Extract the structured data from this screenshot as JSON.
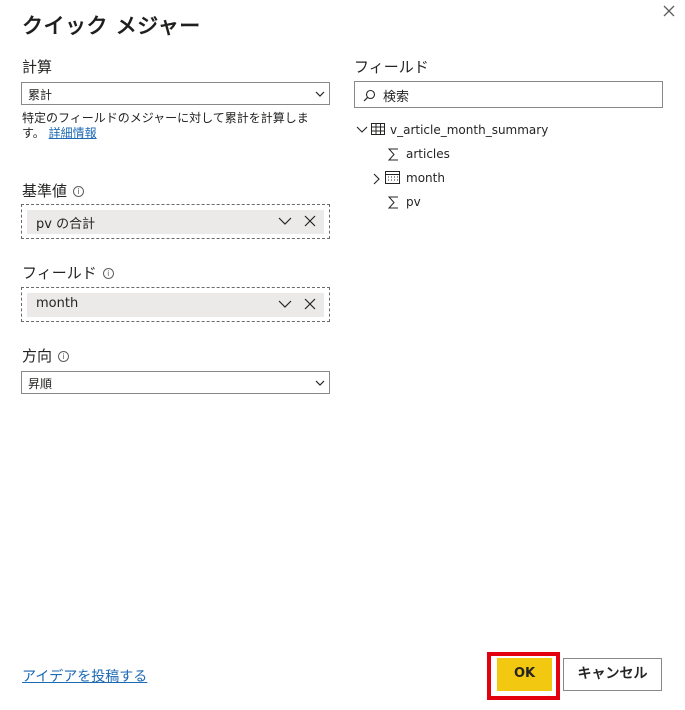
{
  "dialog": {
    "title": "クイック メジャー",
    "close_icon": "close-icon"
  },
  "calculation": {
    "label": "計算",
    "selected": "累計",
    "description": "特定のフィールドのメジャーに対して累計を計算します。",
    "learn_more": "詳細情報"
  },
  "base_value": {
    "label": "基準値",
    "value": "pv の合計"
  },
  "field": {
    "label": "フィールド",
    "value": "month"
  },
  "direction": {
    "label": "方向",
    "selected": "昇順"
  },
  "fields_pane": {
    "label": "フィールド",
    "search_placeholder": "検索",
    "table_name": "v_article_month_summary",
    "items": [
      {
        "label": "articles",
        "icon": "sigma-icon"
      },
      {
        "label": "month",
        "icon": "calendar-icon"
      },
      {
        "label": "pv",
        "icon": "sigma-icon"
      }
    ]
  },
  "footer": {
    "idea_link": "アイデアを投稿する",
    "ok_label": "OK",
    "cancel_label": "キャンセル",
    "highlight_color": "#e3000f",
    "ok_color": "#f2c811"
  }
}
